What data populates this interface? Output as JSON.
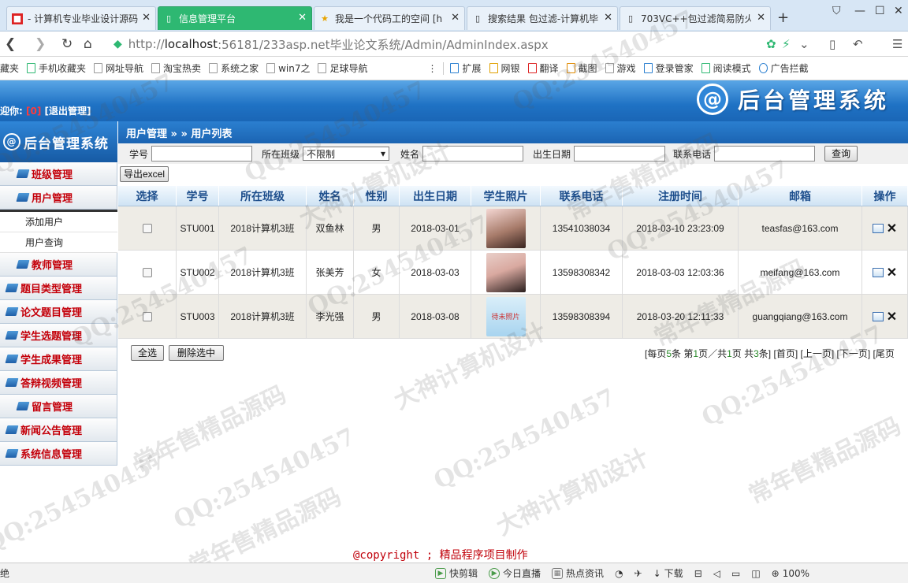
{
  "browser": {
    "tabs": [
      {
        "label": "- 计算机专业毕业设计源码",
        "icon": "flag-icon",
        "active": false
      },
      {
        "label": "信息管理平台",
        "icon": "page-icon",
        "active": true
      },
      {
        "label": "我是一个代码工的空间 [h",
        "icon": "star-icon",
        "active": false
      },
      {
        "label": "搜索结果 包过滤-计算机毕",
        "icon": "page-icon",
        "active": false
      },
      {
        "label": "703VC++包过滤简易防火",
        "icon": "page-icon",
        "active": false
      }
    ],
    "url_prefix": "http://",
    "url_host": "localhost",
    "url_rest": ":56181/233asp.net毕业论文系统/Admin/AdminIndex.aspx",
    "favorites": [
      "藏夹",
      "手机收藏夹",
      "网址导航",
      "淘宝热卖",
      "系统之家",
      "win7之",
      "足球导航"
    ],
    "tools": [
      "扩展",
      "网银",
      "翻译",
      "截图",
      "游戏",
      "登录管家",
      "阅读模式",
      "广告拦截"
    ]
  },
  "header": {
    "welcome": "迎你:",
    "user_id": "[0]",
    "logout": "[退出管理]",
    "logo_text": "后台管理系统",
    "logo_symbol": "@"
  },
  "sidebar": {
    "logo_text": "后台管理系统",
    "items": [
      {
        "label": "班级管理",
        "indent": true
      },
      {
        "label": "用户管理",
        "indent": true,
        "expanded": true,
        "children": [
          "添加用户",
          "用户查询"
        ]
      },
      {
        "label": "教师管理",
        "indent": true
      },
      {
        "label": "题目类型管理",
        "indent": false
      },
      {
        "label": "论文题目管理",
        "indent": false
      },
      {
        "label": "学生选题管理",
        "indent": false
      },
      {
        "label": "学生成果管理",
        "indent": false
      },
      {
        "label": "答辩视频管理",
        "indent": false
      },
      {
        "label": "留言管理",
        "indent": true
      },
      {
        "label": "新闻公告管理",
        "indent": false
      },
      {
        "label": "系统信息管理",
        "indent": false
      }
    ]
  },
  "breadcrumb": "用户管理 » » 用户列表",
  "search": {
    "student_no_label": "学号",
    "class_label": "所在班级",
    "class_value": "不限制",
    "name_label": "姓名",
    "birth_label": "出生日期",
    "phone_label": "联系电话",
    "query_button": "查询"
  },
  "export_button": "导出excel",
  "table": {
    "columns": [
      "选择",
      "学号",
      "所在班级",
      "姓名",
      "性别",
      "出生日期",
      "学生照片",
      "联系电话",
      "注册时间",
      "邮箱",
      "操作"
    ],
    "rows": [
      {
        "no": "STU001",
        "class": "2018计算机3班",
        "name": "双鱼林",
        "sex": "男",
        "birth": "2018-03-01",
        "phone": "13541038034",
        "reg": "2018-03-10 23:23:09",
        "email": "teasfas@163.com",
        "photo": "p1",
        "photo_text": ""
      },
      {
        "no": "STU002",
        "class": "2018计算机3班",
        "name": "张美芳",
        "sex": "女",
        "birth": "2018-03-03",
        "phone": "13598308342",
        "reg": "2018-03-03 12:03:36",
        "email": "meifang@163.com",
        "photo": "p2",
        "photo_text": ""
      },
      {
        "no": "STU003",
        "class": "2018计算机3班",
        "name": "李光强",
        "sex": "男",
        "birth": "2018-03-08",
        "phone": "13598308394",
        "reg": "2018-03-20 12:11:33",
        "email": "guangqiang@163.com",
        "photo": "p3",
        "photo_text": "待未照片"
      }
    ]
  },
  "footer": {
    "select_all": "全选",
    "delete_selected": "删除选中",
    "pager_pre": "[每页",
    "pager_per": "5",
    "pager_mid1": "条 第",
    "pager_cur": "1",
    "pager_mid2": "页／共",
    "pager_total": "1",
    "pager_mid3": "页 共",
    "pager_count": "3",
    "pager_end": "条]",
    "first": "[首页]",
    "prev": "[上一页]",
    "next": "[下一页]",
    "last": "[尾页"
  },
  "copyright_en": "@copyright",
  "copyright_sep": " ; ",
  "copyright_cn": "精品程序项目制作",
  "status": {
    "left": "绝",
    "items": [
      "快剪辑",
      "今日直播",
      "热点资讯",
      "下载"
    ],
    "zoom": "100%"
  },
  "watermarks": [
    "QQ:254540457",
    "常年售精品源码",
    "大神计算机设计"
  ]
}
